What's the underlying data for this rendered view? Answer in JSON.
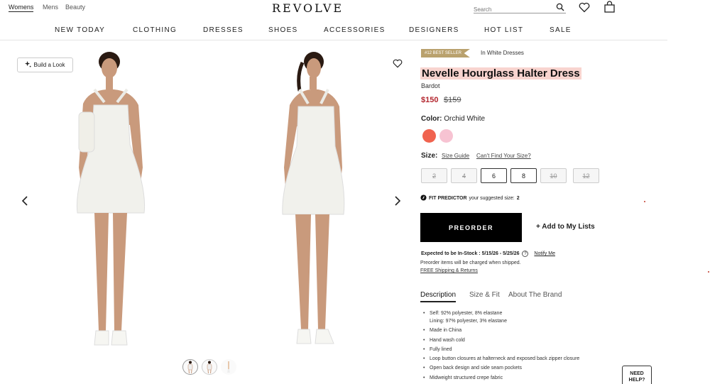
{
  "top": {
    "segments": [
      "Womens",
      "Mens",
      "Beauty"
    ],
    "logo": "REVOLVE",
    "search_placeholder": "Search"
  },
  "nav": [
    "NEW TODAY",
    "CLOTHING",
    "DRESSES",
    "SHOES",
    "ACCESSORIES",
    "DESIGNERS",
    "HOT LIST",
    "SALE"
  ],
  "gallery": {
    "build_look": "Build a Look",
    "prev_icon": "chevron-left-icon",
    "next_icon": "chevron-right-icon",
    "thumbnail_count": 3,
    "selected_thumbnail": 1
  },
  "product": {
    "badge": "#12 BEST SELLER",
    "category": "In White Dresses",
    "title": "Nevelle Hourglass Halter Dress",
    "brand": "Bardot",
    "price": "$150",
    "original_price": "$159",
    "color_label": "Color:",
    "color_value": "Orchid White",
    "swatches": [
      "#f0634f",
      "#f7c3d2"
    ],
    "size_label": "Size:",
    "size_guide": "Size Guide",
    "cant_find": "Can't Find Your Size?",
    "sizes": [
      {
        "label": "2",
        "available": false
      },
      {
        "label": "4",
        "available": false
      },
      {
        "label": "6",
        "available": true
      },
      {
        "label": "8",
        "available": true
      },
      {
        "label": "10",
        "available": false
      },
      {
        "label": "12",
        "available": false
      }
    ],
    "fit_predictor": "FIT PREDICTOR",
    "fit_suggest": "your suggested size:",
    "fit_size": "2",
    "preorder": "PREORDER",
    "add_to_lists": "+ Add to My Lists",
    "instock_label": "Expected to be In-Stock : 5/15/26 - 5/25/26",
    "notify": "Notify Me",
    "charged": "Preorder items will be charged when shipped.",
    "free_shipping": "FREE Shipping & Returns"
  },
  "tabs": [
    "Description",
    "Size & Fit",
    "About The Brand"
  ],
  "details": [
    "Self: 92% polyester, 8% elastane",
    "Lining: 97% polyester, 3% elastane",
    "Made in China",
    "Hand wash cold",
    "Fully lined",
    "Loop button closures at halterneck and exposed back zipper closure",
    "Open back design and side seam pockets",
    "Midweight structured crepe fabric"
  ],
  "help": [
    "NEED",
    "HELP?"
  ],
  "colors": {
    "accent_red": "#b3262e",
    "badge_gold": "#b9a16d",
    "title_highlight": "#f8d4cf"
  }
}
